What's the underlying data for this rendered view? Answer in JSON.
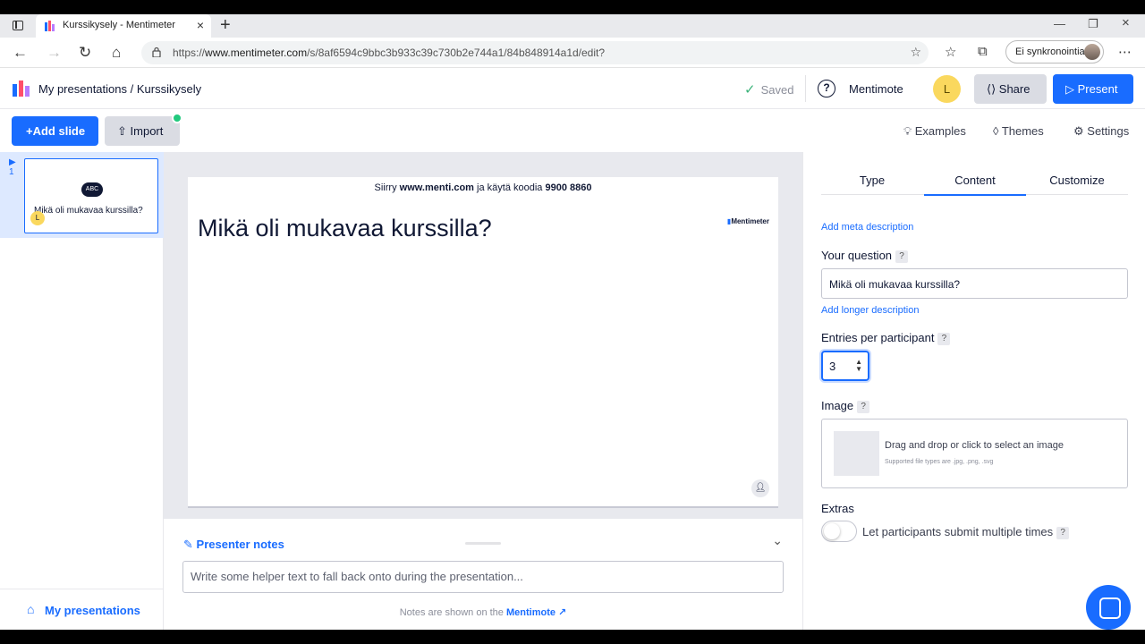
{
  "browser": {
    "tab_title": "Kurssikysely - Mentimeter",
    "url_prefix": "https://",
    "url_host": "www.mentimeter.com",
    "url_path": "/s/8af6594c9bbc3b933c39c730b2e744a1/84b848914a1d/edit?",
    "sync_label": "Ei synkronointia"
  },
  "header": {
    "my_presentations": "My presentations",
    "separator": "/",
    "presentation_name": "Kurssikysely",
    "saved": "Saved",
    "mentimote": "Mentimote",
    "avatar_initial": "L",
    "share": "Share",
    "present": "Present"
  },
  "toolbar": {
    "add_slide": "Add slide",
    "import": "Import",
    "examples": "Examples",
    "themes": "Themes",
    "settings": "Settings"
  },
  "slides": [
    {
      "number": "1",
      "icon_text": "ABC",
      "title": "Mikä oli mukavaa kurssilla?",
      "avatar": "L"
    }
  ],
  "sidebar_footer": "My presentations",
  "slide_preview": {
    "instruction_prefix": "Siirry ",
    "instruction_site": "www.menti.com",
    "instruction_middle": " ja käytä koodia ",
    "instruction_code": "9900 8860",
    "title": "Mikä oli mukavaa kurssilla?",
    "brand": "Mentimeter"
  },
  "notes": {
    "title": "Presenter notes",
    "placeholder": "Write some helper text to fall back onto during the presentation...",
    "info_prefix": "Notes are shown on the",
    "info_link": "Mentimote"
  },
  "panel": {
    "tabs": [
      "Type",
      "Content",
      "Customize"
    ],
    "active_tab": "Content",
    "add_meta": "Add meta description",
    "question_label": "Your question",
    "question_value": "Mikä oli mukavaa kurssilla?",
    "add_longer": "Add longer description",
    "entries_label": "Entries per participant",
    "entries_value": "3",
    "image_label": "Image",
    "drop_text": "Drag and drop or click to select an image",
    "drop_sub": "Supported file types are .jpg, .png, .svg",
    "extras_label": "Extras",
    "toggle_label": "Let participants submit multiple times",
    "help_mark": "?"
  },
  "colors": {
    "accent": "#196cff",
    "avatar": "#fad85e",
    "saved_check": "#3cb37a"
  }
}
